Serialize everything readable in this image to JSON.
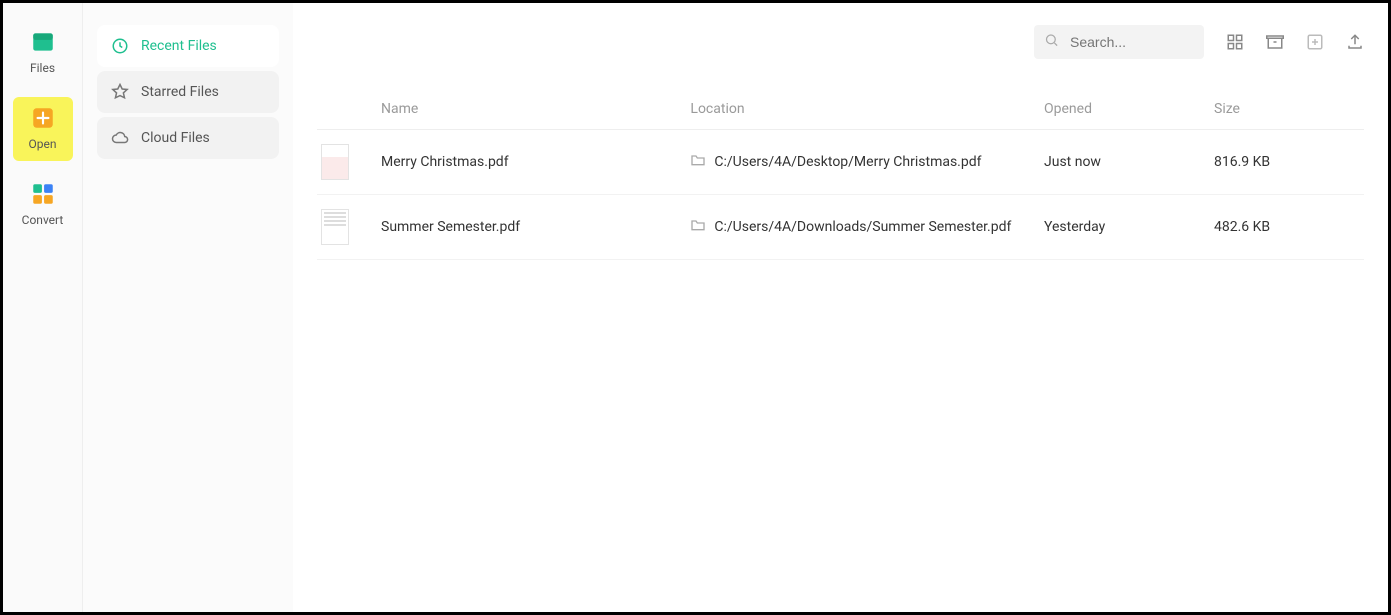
{
  "toolbar": {
    "files": {
      "label": "Files"
    },
    "open": {
      "label": "Open"
    },
    "convert": {
      "label": "Convert"
    }
  },
  "sidebar": {
    "recent": {
      "label": "Recent Files"
    },
    "starred": {
      "label": "Starred Files"
    },
    "cloud": {
      "label": "Cloud Files"
    }
  },
  "search": {
    "placeholder": "Search..."
  },
  "columns": {
    "name": "Name",
    "location": "Location",
    "opened": "Opened",
    "size": "Size"
  },
  "files": [
    {
      "name": "Merry Christmas.pdf",
      "location": "C:/Users/4A/Desktop/Merry Christmas.pdf",
      "opened": "Just now",
      "size": "816.9 KB"
    },
    {
      "name": "Summer Semester.pdf",
      "location": "C:/Users/4A/Downloads/Summer Semester.pdf",
      "opened": "Yesterday",
      "size": "482.6 KB"
    }
  ]
}
